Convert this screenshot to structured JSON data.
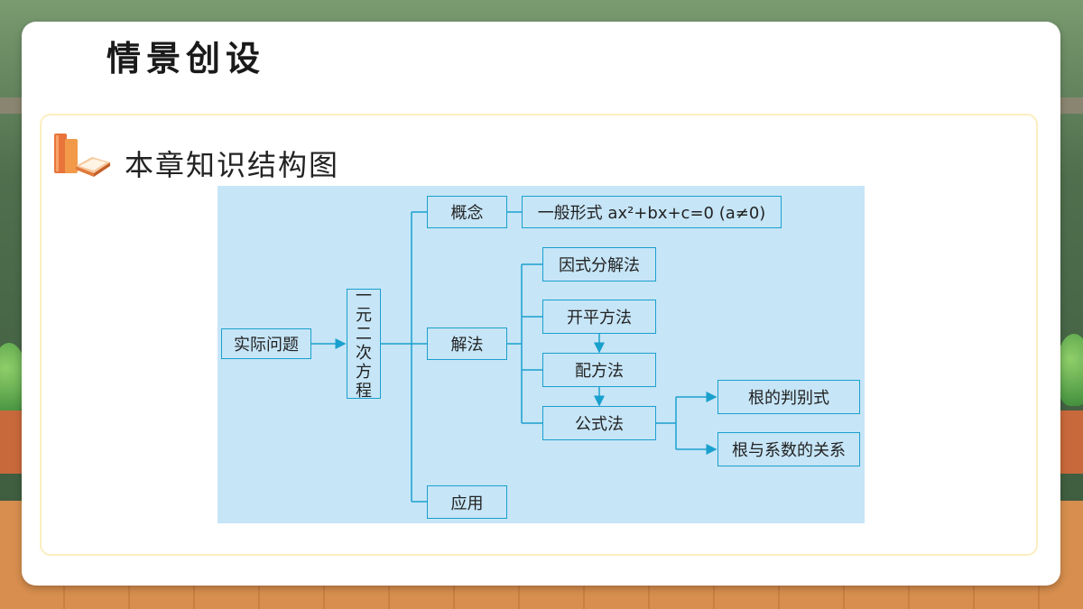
{
  "header": {
    "title": "情景创设"
  },
  "section": {
    "title": "本章知识结构图",
    "icon": "books-icon"
  },
  "diagram": {
    "nodes": {
      "practical": "实际问题",
      "equation": [
        "一",
        "元",
        "二",
        "次",
        "方",
        "程"
      ],
      "concept": "概念",
      "general_form": "一般形式 ax²+bx+c=0 (a≠0)",
      "solutions": "解法",
      "factoring": "因式分解法",
      "square_root": "开平方法",
      "completing_square": "配方法",
      "formula": "公式法",
      "discriminant": "根的判别式",
      "vieta": "根与系数的关系",
      "application": "应用"
    }
  },
  "colors": {
    "diagram_bg": "#c6e5f7",
    "line": "#1aa0cd",
    "card_border": "#fbeec0"
  }
}
